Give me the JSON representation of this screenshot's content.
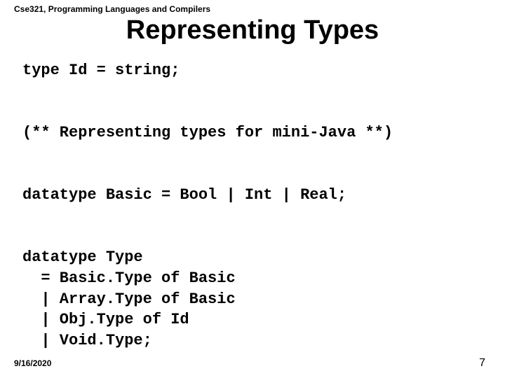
{
  "course_header": "Cse321, Programming Languages and Compilers",
  "title": "Representing Types",
  "code": {
    "line1": "type Id = string;",
    "line2": "(** Representing types for mini-Java **)",
    "line3": "datatype Basic = Bool | Int | Real;",
    "line4": "datatype Type",
    "line5": "  = Basic.Type of Basic",
    "line6": "  | Array.Type of Basic",
    "line7": "  | Obj.Type of Id",
    "line8": "  | Void.Type;"
  },
  "footer": {
    "date": "9/16/2020",
    "page": "7"
  }
}
